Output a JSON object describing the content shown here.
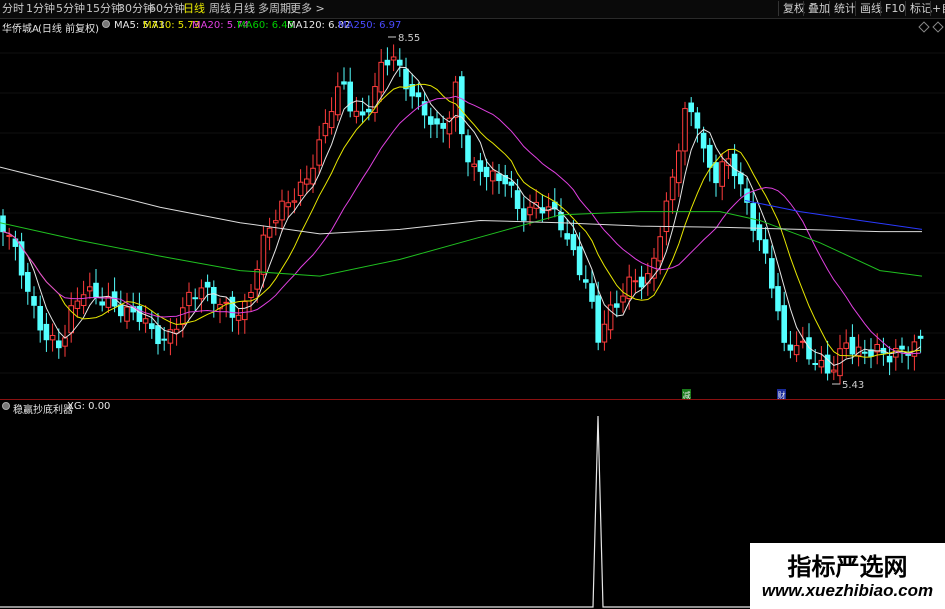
{
  "toolbar": {
    "periods": [
      "分时",
      "1分钟",
      "5分钟",
      "15分钟",
      "30分钟",
      "60分钟",
      "日线",
      "周线",
      "月线",
      "多周期",
      "更多 >"
    ],
    "active_period": "日线",
    "right_buttons": [
      "复权",
      "叠加",
      "统计",
      "画线",
      "F10",
      "标记"
    ],
    "far_right": "+自"
  },
  "infobar": {
    "stock": "华侨城A",
    "mode": "(日线 前复权)",
    "ma": [
      {
        "label": "MA5: 5.73",
        "color": "#e6e6e6"
      },
      {
        "label": "MA10: 5.73",
        "color": "#e6e600"
      },
      {
        "label": "MA20: 5.74",
        "color": "#e040e0"
      },
      {
        "label": "MA60: 6.45",
        "color": "#00d000"
      },
      {
        "label": "MA120: 6.82",
        "color": "#e6e6e6"
      },
      {
        "label": "MA250: 6.97",
        "color": "#4a4aff"
      }
    ]
  },
  "chart_data": {
    "type": "candlestick",
    "high_label": "8.55",
    "low_label": "5.43",
    "event_markers": [
      "减",
      "财"
    ],
    "colors": {
      "up": "#ff3c3c",
      "down": "#54ffff",
      "ma5": "#e6e6e6",
      "ma10": "#e6e600",
      "ma20": "#e040e0",
      "ma60": "#20c020",
      "ma120": "#dcdcdc",
      "ma250": "#2a3aff"
    }
  },
  "indicator": {
    "name": "稳赢抄底利器",
    "xg": "XG: 0.00",
    "line_color": "#e6e6e6"
  },
  "watermark": {
    "title": "指标严选网",
    "url": "www.xuezhibiao.com"
  }
}
